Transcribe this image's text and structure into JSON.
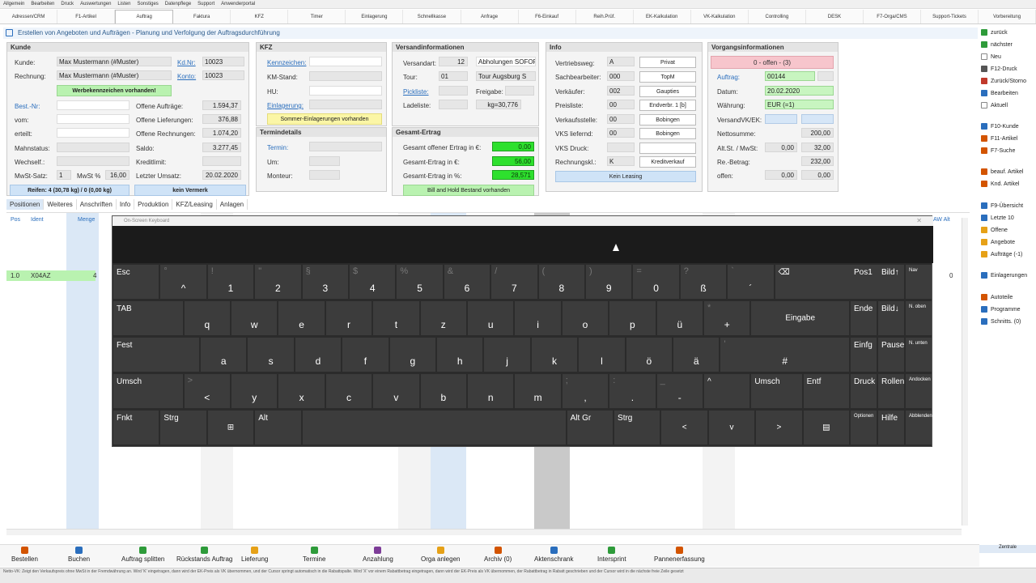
{
  "menu": [
    "Allgemein",
    "Bearbeiten",
    "Druck",
    "Auswertungen",
    "Listen",
    "Sonstiges",
    "Datenpflege",
    "Support",
    "Anwenderportal"
  ],
  "tabs": [
    "Adressen/CRM",
    "F1-Artikel",
    "Auftrag",
    "Faktura",
    "KFZ",
    "Timer",
    "Einlagerung",
    "Schnellkasse",
    "Anfrage",
    "F6-Einkauf",
    "Reih.Prüf.",
    "EK-Kalkulation",
    "VK-Kalkulation",
    "Controlling",
    "DESK",
    "F7-Orga/CMS",
    "Support-Tickets",
    "Vorbereitung"
  ],
  "active_tab": "Auftrag",
  "headline": "Erstellen von Angeboten und Aufträgen - Planung und Verfolgung der Auftragsdurchführung",
  "kunde": {
    "title": "Kunde",
    "kunde_label": "Kunde:",
    "kunde_value": "Max Mustermann (#Muster)",
    "kdnr_label": "Kd.Nr:",
    "kdnr_value": "10023",
    "rechnung_label": "Rechnung:",
    "rechnung_value": "Max Mustermann (#Muster)",
    "konto_label": "Konto:",
    "konto_value": "10023",
    "werbe_button": "Werbekennzeichen vorhanden!",
    "bestnr_label": "Best.-Nr:",
    "vom_label": "vom:",
    "erteilt_label": "erteilt:",
    "mahnstatus_label": "Mahnstatus:",
    "wechself_label": "Wechself.:",
    "mwst_satz_label": "MwSt-Satz:",
    "mwst_satz_value": "1",
    "mwst_pct_label": "MwSt %",
    "mwst_pct_value": "16,00",
    "offene_auftraege_label": "Offene Aufträge:",
    "offene_auftraege_value": "1.594,37",
    "offene_lieferungen_label": "Offene Lieferungen:",
    "offene_lieferungen_value": "376,88",
    "offene_rechnungen_label": "Offene Rechnungen:",
    "offene_rechnungen_value": "1.074,20",
    "saldo_label": "Saldo:",
    "saldo_value": "3.277,45",
    "kreditlimit_label": "Kreditlimit:",
    "letzter_umsatz_label": "Letzter Umsatz:",
    "letzter_umsatz_value": "20.02.2020",
    "reifen_button": "Reifen: 4 (30,78 kg) / 0 (0,00 kg)",
    "vermerk_button": "kein Vermerk"
  },
  "kfz": {
    "title": "KFZ",
    "kennzeichen_label": "Kennzeichen:",
    "kmstand_label": "KM-Stand:",
    "hu_label": "HU:",
    "einlagerung_label": "Einlagerung:",
    "sommer_button": "Sommer-Einlagerungen vorhanden"
  },
  "termin": {
    "title": "Termindetails",
    "termin_label": "Termin:",
    "um_label": "Um:",
    "monteur_label": "Monteur:"
  },
  "versand": {
    "title": "Versandinformationen",
    "versandart_label": "Versandart:",
    "versandart_value": "12",
    "versandart_text": "Abholungen SOFOR",
    "tour_label": "Tour:",
    "tour_value": "01",
    "tour_text": "Tour Augsburg S",
    "pickliste_label": "Pickliste:",
    "freigabe_label": "Freigabe:",
    "ladeliste_label": "Ladeliste:",
    "gewicht_value": "kg=30,776"
  },
  "ertrag": {
    "title": "Gesamt-Ertrag",
    "offen_label": "Gesamt offener Ertrag in €:",
    "offen_value": "0,00",
    "eur_label": "Gesamt-Ertrag in €:",
    "eur_value": "56,00",
    "pct_label": "Gesamt-Ertrag in %:",
    "pct_value": "28,571",
    "bill_button": "Bill and Hold Bestand vorhanden"
  },
  "info": {
    "title": "Info",
    "vertriebsweg_label": "Vertriebsweg:",
    "vertriebsweg_value": "A",
    "vertriebsweg_text": "Privat",
    "sachbearbeiter_label": "Sachbearbeiter:",
    "sachbearbeiter_value": "000",
    "sachbearbeiter_text": "TopM",
    "verkaeufer_label": "Verkäufer:",
    "verkaeufer_value": "002",
    "verkaeufer_text": "Gaupties",
    "preisliste_label": "Preisliste:",
    "preisliste_value": "00",
    "preisliste_text": "Endverbr. 1 [b]",
    "verkaufsstelle_label": "Verkaufsstelle:",
    "verkaufsstelle_value": "00",
    "verkaufsstelle_text": "Bobingen",
    "vks_liefernd_label": "VKS liefernd:",
    "vks_liefernd_value": "00",
    "vks_liefernd_text": "Bobingen",
    "vks_druck_label": "VKS Druck:",
    "rechnungskl_label": "Rechnungskl.:",
    "rechnungskl_value": "K",
    "rechnungskl_text": "Kreditverkauf",
    "leasing_button": "Kein Leasing"
  },
  "vorgang": {
    "title": "Vorgangsinformationen",
    "status": "0 - offen - (3)",
    "auftrag_label": "Auftrag:",
    "auftrag_value": "00144",
    "datum_label": "Datum:",
    "datum_value": "20.02.2020",
    "waehrung_label": "Währung:",
    "waehrung_value": "EUR (=1)",
    "versandvk_label": "VersandVK/EK:",
    "netto_label": "Nettosumme:",
    "netto_value": "200,00",
    "altst_label": "Alt.St. / MwSt:",
    "altst_value": "0,00",
    "mwst_value": "32,00",
    "rebetrag_label": "Re.-Betrag:",
    "rebetrag_value": "232,00",
    "offen_label": "offen:",
    "offen_value1": "0,00",
    "offen_value2": "0,00"
  },
  "subtabs": [
    "Positionen",
    "Weiteres",
    "Anschriften",
    "Info",
    "Produktion",
    "KFZ/Leasing",
    "Anlagen"
  ],
  "grid": {
    "headers": [
      "Pos",
      "Ident",
      "Menge"
    ],
    "right_header": "AW Alt",
    "row": {
      "pos": "1.0",
      "ident": "X04AZ",
      "menge": "4",
      "end_value": "0"
    }
  },
  "osk": {
    "title": "On-Screen Keyboard",
    "rows": [
      [
        {
          "l": "Esc",
          "t": "lab"
        },
        {
          "m": "^",
          "s": "°"
        },
        {
          "m": "1",
          "s": "!"
        },
        {
          "m": "2",
          "s": "\""
        },
        {
          "m": "3",
          "s": "§"
        },
        {
          "m": "4",
          "s": "$"
        },
        {
          "m": "5",
          "s": "%"
        },
        {
          "m": "6",
          "s": "&"
        },
        {
          "m": "7",
          "s": "/"
        },
        {
          "m": "8",
          "s": "("
        },
        {
          "m": "9",
          "s": ")"
        },
        {
          "m": "0",
          "s": "="
        },
        {
          "m": "ß",
          "s": "?"
        },
        {
          "m": "´",
          "s": "`"
        },
        {
          "l": "⌫",
          "t": "lab"
        }
      ],
      [
        {
          "l": "TAB",
          "t": "lab"
        },
        {
          "m": "q"
        },
        {
          "m": "w"
        },
        {
          "m": "e"
        },
        {
          "m": "r"
        },
        {
          "m": "t"
        },
        {
          "m": "z"
        },
        {
          "m": "u"
        },
        {
          "m": "i"
        },
        {
          "m": "o"
        },
        {
          "m": "p"
        },
        {
          "m": "ü"
        },
        {
          "m": "+",
          "s": "*"
        },
        {
          "l": "Eingabe",
          "t": "clab"
        }
      ],
      [
        {
          "l": "Fest",
          "t": "lab"
        },
        {
          "m": "a"
        },
        {
          "m": "s"
        },
        {
          "m": "d"
        },
        {
          "m": "f"
        },
        {
          "m": "g"
        },
        {
          "m": "h"
        },
        {
          "m": "j"
        },
        {
          "m": "k"
        },
        {
          "m": "l"
        },
        {
          "m": "ö"
        },
        {
          "m": "ä"
        },
        {
          "m": "#",
          "s": "'"
        }
      ],
      [
        {
          "l": "Umsch",
          "t": "lab"
        },
        {
          "m": "<",
          "s": ">"
        },
        {
          "m": "y"
        },
        {
          "m": "x"
        },
        {
          "m": "c"
        },
        {
          "m": "v"
        },
        {
          "m": "b"
        },
        {
          "m": "n"
        },
        {
          "m": "m"
        },
        {
          "m": ",",
          "s": ";"
        },
        {
          "m": ".",
          "s": ":"
        },
        {
          "m": "-",
          "s": "_"
        },
        {
          "l": "^",
          "t": "lab"
        },
        {
          "l": "Umsch",
          "t": "lab"
        },
        {
          "l": "Entf",
          "t": "lab"
        }
      ],
      [
        {
          "l": "Fnkt",
          "t": "lab"
        },
        {
          "l": "Strg",
          "t": "lab"
        },
        {
          "l": "⊞",
          "t": "clab"
        },
        {
          "l": "Alt",
          "t": "lab"
        },
        {
          "l": "",
          "t": "lab"
        },
        {
          "l": "Alt Gr",
          "t": "lab"
        },
        {
          "l": "Strg",
          "t": "lab"
        },
        {
          "l": "<",
          "t": "clab"
        },
        {
          "l": "v",
          "t": "clab"
        },
        {
          "l": ">",
          "t": "clab"
        },
        {
          "l": "▤",
          "t": "clab"
        }
      ]
    ],
    "side": [
      [
        "Pos1",
        "Bild↑",
        "Nav"
      ],
      [
        "Ende",
        "Bild↓",
        "N. oben"
      ],
      [
        "Einfg",
        "Pause",
        "N. unten"
      ],
      [
        "Druck",
        "Rollen",
        "Andocken"
      ],
      [
        "Optionen",
        "Hilfe",
        "Abblenden"
      ]
    ]
  },
  "rightpanel": [
    {
      "label": "zurück",
      "color": "#2e9b3a"
    },
    {
      "label": "nächster",
      "color": "#2e9b3a"
    },
    {
      "label": "Neu",
      "color": "#ffffff"
    },
    {
      "label": "F12-Druck",
      "color": "#555555"
    },
    {
      "label": "Zurück/Storno",
      "color": "#c0392b"
    },
    {
      "label": "Bearbeiten",
      "color": "#2a6ebd"
    },
    {
      "label": "Aktuell",
      "color": "#ffffff"
    },
    {
      "label": "F10-Kunde",
      "color": "#2a6ebd"
    },
    {
      "label": "F11-Artikel",
      "color": "#d35400"
    },
    {
      "label": "F7-Suche",
      "color": "#d35400"
    },
    {
      "label": "beauf. Artikel",
      "color": "#d35400"
    },
    {
      "label": "Knd. Artikel",
      "color": "#d35400"
    },
    {
      "label": "F9-Übersicht",
      "color": "#2a6ebd"
    },
    {
      "label": "Letzte 10",
      "color": "#2a6ebd"
    },
    {
      "label": "Offene",
      "color": "#e6a117"
    },
    {
      "label": "Angebote",
      "color": "#e6a117"
    },
    {
      "label": "Aufträge (-1)",
      "color": "#e6a117"
    },
    {
      "label": "Einlagerungen",
      "color": "#2a6ebd"
    },
    {
      "label": "Autoteile",
      "color": "#d35400"
    },
    {
      "label": "Programme",
      "color": "#2a6ebd"
    },
    {
      "label": "Schnitts. (0)",
      "color": "#2a6ebd"
    }
  ],
  "toolbar": [
    {
      "label": "Bestellen",
      "color": "#d35400"
    },
    {
      "label": "Buchen",
      "color": "#2a6ebd"
    },
    {
      "label": "Auftrag splitten",
      "color": "#2e9b3a"
    },
    {
      "label": "Rückstands Auftrag",
      "color": "#2e9b3a"
    },
    {
      "label": "Lieferung",
      "color": "#e6a117"
    },
    {
      "label": "Termine",
      "color": "#2e9b3a"
    },
    {
      "label": "Anzahlung",
      "color": "#7d3c98"
    },
    {
      "label": "Orga anlegen",
      "color": "#e6a117"
    },
    {
      "label": "Archiv (0)",
      "color": "#d35400"
    },
    {
      "label": "Aktenschrank",
      "color": "#2a6ebd"
    },
    {
      "label": "Intersprint",
      "color": "#2e9b3a"
    },
    {
      "label": "Pannenerfassung",
      "color": "#d35400"
    }
  ],
  "zentrale": "Zentrale",
  "statusbar": "Netto-VK: Zeigt den Verkaufspreis ohne MwSt in der Fremdwährung an. Wird 'K' eingetragen, dann wird der EK-Preis als VK übernommen, und der Cursor springt automatisch in die Rabattspalte. Wird 'X' vor einem Rabattbetrag eingetragen, dann wird der EK-Preis als VK übernommen, der Rabattbetrag in Rabatt geschrieben und der Cursor wird in die nächste freie Zeile gesetzt"
}
